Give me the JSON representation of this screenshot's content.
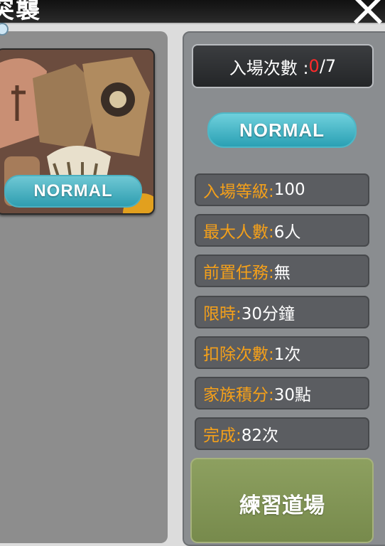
{
  "window": {
    "title": "突襲"
  },
  "left": {
    "card_badge": "NORMAL"
  },
  "right": {
    "entry": {
      "label": "入場次數 : ",
      "used": "0",
      "sep": " / ",
      "max": "7"
    },
    "mode_badge": "NORMAL",
    "info": [
      {
        "key": "入場等級:",
        "value": " 100"
      },
      {
        "key": "最大人數:",
        "value": " 6人"
      },
      {
        "key": "前置任務:",
        "value": " 無"
      },
      {
        "key": "限時:",
        "value": " 30分鐘"
      },
      {
        "key": "扣除次數:",
        "value": " 1次"
      },
      {
        "key": "家族積分:",
        "value": " 30點"
      },
      {
        "key": "完成:",
        "value": " 82次"
      }
    ],
    "practice_button": "練習道場"
  },
  "colors": {
    "label": "#f4a01a",
    "badge": "#2aa0b4",
    "count_zero": "#ff2a2a",
    "button": "#8da060"
  }
}
